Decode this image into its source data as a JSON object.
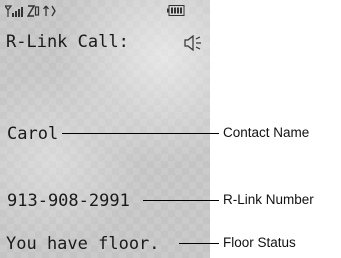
{
  "screen": {
    "title": "R-Link Call:",
    "contact_name": "Carol",
    "rlink_number": "913-908-2991",
    "floor_status": "You have floor."
  },
  "status_bar": {
    "icons": [
      "signal-strength-icon",
      "data-icon",
      "sync-icon",
      "battery-icon"
    ]
  },
  "callouts": {
    "contact_name": "Contact Name",
    "rlink_number": "R-Link Number",
    "floor_status": "Floor Status"
  },
  "colors": {
    "screen_background": "#c4c4c4",
    "text": "#1a1a1a",
    "leader_line": "#000000"
  }
}
